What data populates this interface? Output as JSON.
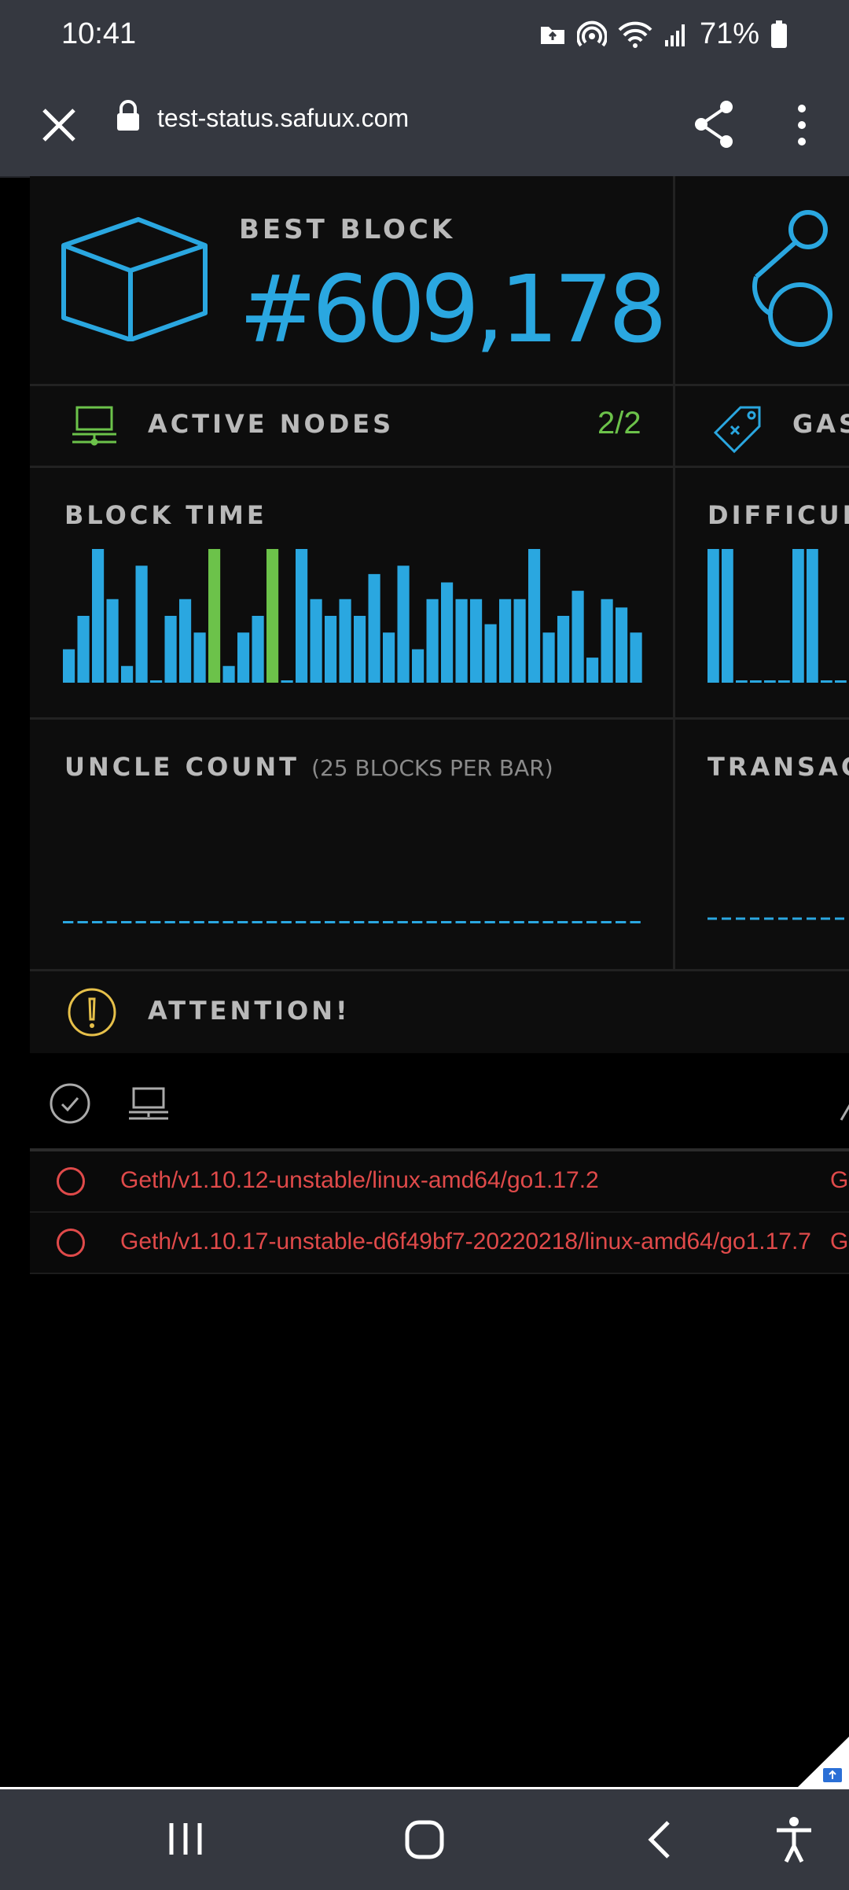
{
  "status_bar": {
    "time": "10:41",
    "battery": "71%",
    "icons": [
      "folder-icon",
      "hotspot-icon",
      "wifi-icon",
      "signal-icon",
      "battery-icon"
    ]
  },
  "browser": {
    "url": "test-status.safuux.com",
    "icons": [
      "close-icon",
      "lock-icon",
      "share-icon",
      "more-icon"
    ]
  },
  "dashboard": {
    "best_block": {
      "label": "BEST BLOCK",
      "value": "#609,178"
    },
    "active_nodes": {
      "label": "ACTIVE NODES",
      "value": "2/2"
    },
    "gas_label": "GAS",
    "block_time": {
      "label": "BLOCK TIME"
    },
    "difficulty_label": "DIFFICULT",
    "uncle_count": {
      "label": "UNCLE COUNT",
      "sub": "(25 BLOCKS PER BAR)"
    },
    "transactions_label": "TRANSACT",
    "attention": {
      "label": "ATTENTION!"
    },
    "accent_color": "#2aa7e0",
    "highlight_color": "#6cc24a",
    "alert_color": "#e04a4a",
    "warning_color": "#e6c04a"
  },
  "nodes": [
    {
      "name": "Geth/v1.10.12-unstable/linux-amd64/go1.17.2",
      "truncated": "Ge"
    },
    {
      "name": "Geth/v1.10.17-unstable-d6f49bf7-20220218/linux-amd64/go1.17.7",
      "truncated": "Ge"
    }
  ],
  "chart_data": [
    {
      "type": "bar",
      "title": "BLOCK TIME",
      "values": [
        4,
        8,
        16,
        10,
        2,
        14,
        0,
        8,
        10,
        6,
        16,
        2,
        6,
        8,
        16,
        0,
        16,
        10,
        8,
        10,
        8,
        13,
        6,
        14,
        4,
        10,
        12,
        10,
        10,
        7,
        10,
        10,
        16,
        6,
        8,
        11,
        3,
        10,
        9,
        6
      ],
      "highlighted_indices": [
        10,
        14
      ],
      "ylim": [
        0,
        16
      ]
    },
    {
      "type": "bar",
      "title": "DIFFICULT",
      "values": [
        16,
        16,
        0,
        0,
        0,
        0,
        16,
        16,
        0,
        0
      ],
      "ylim": [
        0,
        16
      ]
    },
    {
      "type": "bar",
      "title": "UNCLE COUNT",
      "values": [
        0,
        0,
        0,
        0,
        0,
        0,
        0,
        0,
        0,
        0,
        0,
        0,
        0,
        0,
        0,
        0,
        0,
        0,
        0,
        0,
        0,
        0,
        0,
        0,
        0,
        0,
        0,
        0,
        0,
        0,
        0,
        0,
        0,
        0,
        0,
        0,
        0,
        0,
        0,
        0
      ],
      "ylim": [
        0,
        1
      ]
    }
  ]
}
